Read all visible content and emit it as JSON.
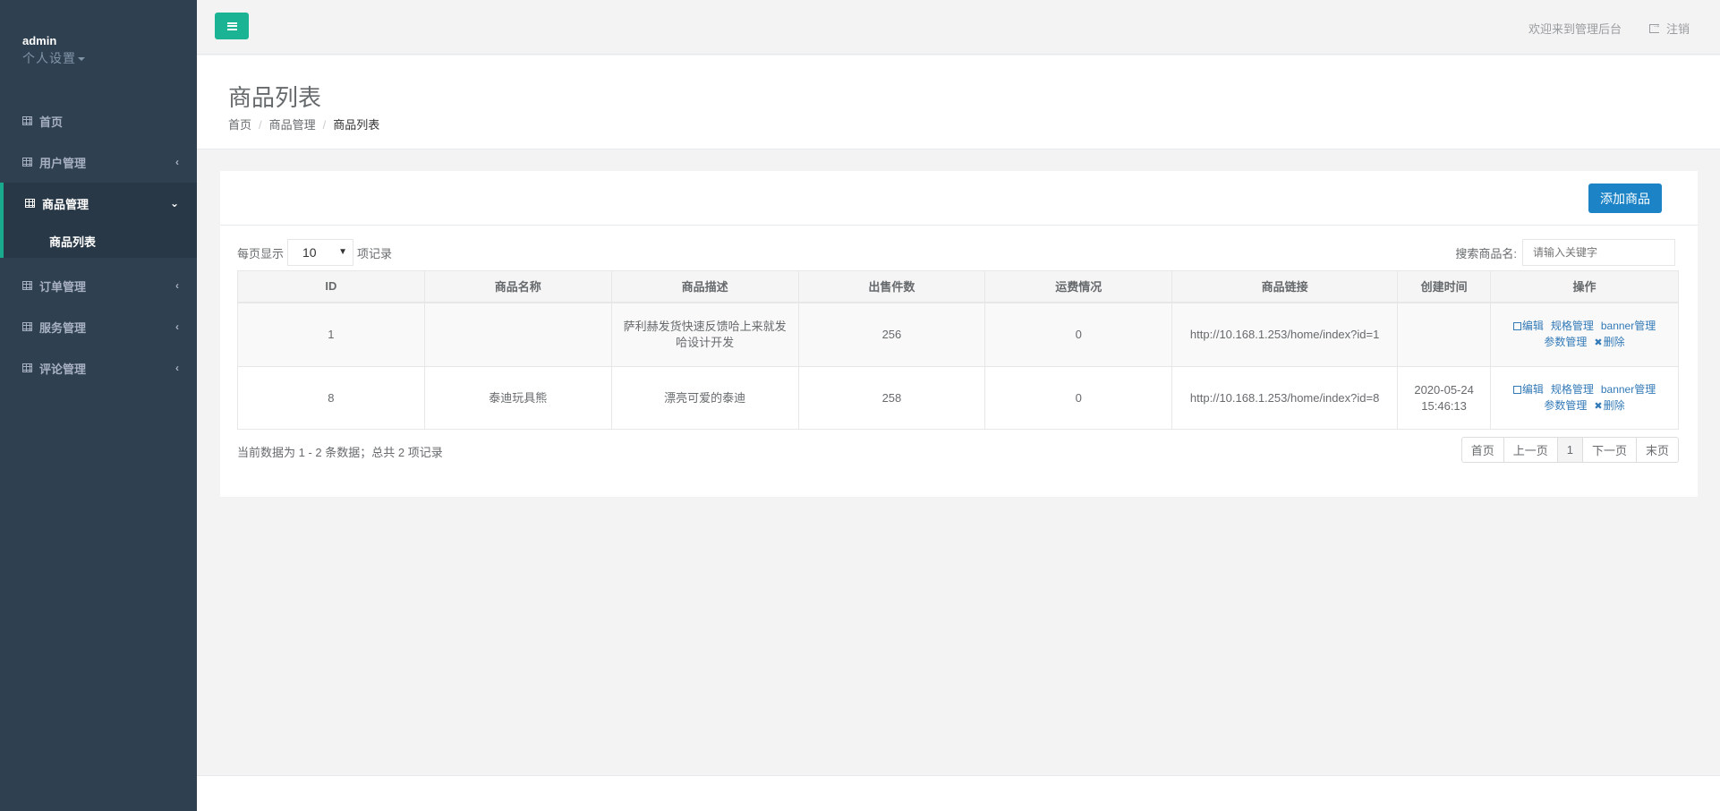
{
  "profile": {
    "name": "admin",
    "settings_label": "个人设置"
  },
  "nav": {
    "home": "首页",
    "users": "用户管理",
    "goods": "商品管理",
    "goods_list": "商品列表",
    "orders": "订单管理",
    "services": "服务管理",
    "reviews": "评论管理"
  },
  "topbar": {
    "welcome": "欢迎来到管理后台",
    "logout": "注销"
  },
  "heading": {
    "title": "商品列表",
    "breadcrumb": [
      "首页",
      "商品管理",
      "商品列表"
    ]
  },
  "toolbar": {
    "add_label": "添加商品"
  },
  "controls": {
    "show_prefix": "每页显示",
    "page_size": "10",
    "show_suffix": "项记录",
    "search_label": "搜索商品名:",
    "search_placeholder": "请输入关键字"
  },
  "table": {
    "columns": [
      "ID",
      "商品名称",
      "商品描述",
      "出售件数",
      "运费情况",
      "商品链接",
      "创建时间",
      "操作"
    ],
    "rows": [
      {
        "id": "1",
        "name": "",
        "desc": "萨利赫发货快速反馈哈上来就发哈设计开发",
        "sold": "256",
        "freight": "0",
        "link": "http://10.168.1.253/home/index?id=1",
        "created": ""
      },
      {
        "id": "8",
        "name": "泰迪玩具熊",
        "desc": "漂亮可爱的泰迪",
        "sold": "258",
        "freight": "0",
        "link": "http://10.168.1.253/home/index?id=8",
        "created": "2020-05-24 15:46:13"
      }
    ],
    "actions": {
      "edit": "编辑",
      "spec": "规格管理",
      "banner": "banner管理",
      "params": "参数管理",
      "delete": "删除"
    }
  },
  "footer_info": "当前数据为 1 - 2 条数据；总共 2 项记录",
  "pager": {
    "first": "首页",
    "prev": "上一页",
    "current": "1",
    "next": "下一页",
    "last": "末页"
  },
  "colors": {
    "sidebar": "#2f4050",
    "accent": "#1ab394",
    "primary": "#1c84c6"
  }
}
